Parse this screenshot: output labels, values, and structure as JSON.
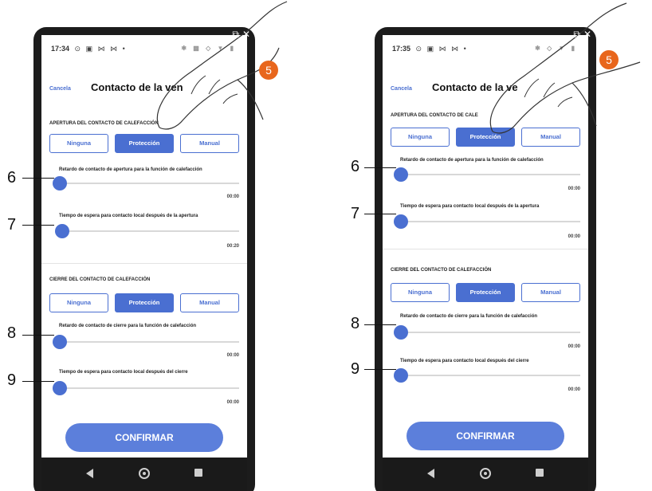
{
  "left": {
    "status_time": "17:34",
    "status_icons": "⊙ ▣ ⋈ ⋈ •",
    "right_status": "✱ ▩ ◇ ▼ ▮",
    "cancel": "Cancela",
    "title": "Contacto de la ven",
    "opening_section": "APERTURA DEL CONTACTO DE CALEFACCIÓN",
    "closing_section": "CIERRE DEL CONTACTO DE CALEFACCIÓN",
    "buttons": [
      "Ninguna",
      "Protección",
      "Manual"
    ],
    "slider6_label": "Retardo de contacto de apertura para la función de calefacción",
    "slider6_value": "00:00",
    "slider6_level": 0,
    "slider7_label": "Tiempo de espera para contacto local después de la apertura",
    "slider7_value": "00:20",
    "slider7_level": 0.02,
    "slider8_label": "Retardo de contacto de cierre para la función de calefacción",
    "slider8_value": "00:00",
    "slider8_level": 0,
    "slider9_label": "Tiempo de espera para contacto local después del cierre",
    "slider9_value": "00:00",
    "slider9_level": 0,
    "confirm": "CONFIRMAR"
  },
  "right": {
    "status_time": "17:35",
    "status_icons": "⊙ ▣ ⋈ ⋈ •",
    "right_status": "✱ ◇ ▼ ▮",
    "cancel": "Cancela",
    "title": "Contacto de la ve",
    "opening_section": "APERTURA DEL CONTACTO DE CALE",
    "closing_section": "CIERRE DEL CONTACTO DE CALEFACCIÓN",
    "buttons": [
      "Ninguna",
      "Protección",
      "Manual"
    ],
    "slider6_label": "Retardo de contacto de apertura para la función de calefacción",
    "slider6_value": "00:00",
    "slider7_label": "Tiempo de espera para contacto local después de la apertura",
    "slider7_value": "00:00",
    "slider8_label": "Retardo de contacto de cierre para la función de calefacción",
    "slider8_value": "00:00",
    "slider9_label": "Tiempo de espera para contacto local después del cierre",
    "slider9_value": "00:00",
    "confirm": "CONFIRMAR"
  },
  "callouts": {
    "step_badge": "5",
    "n6": "6",
    "n7": "7",
    "n8": "8",
    "n9": "9"
  },
  "overlay_icons": [
    "⧉",
    "✕"
  ],
  "colors": {
    "accent": "#4a6fd1",
    "confirm": "#5c7fdb",
    "badge": "#e8661c"
  }
}
